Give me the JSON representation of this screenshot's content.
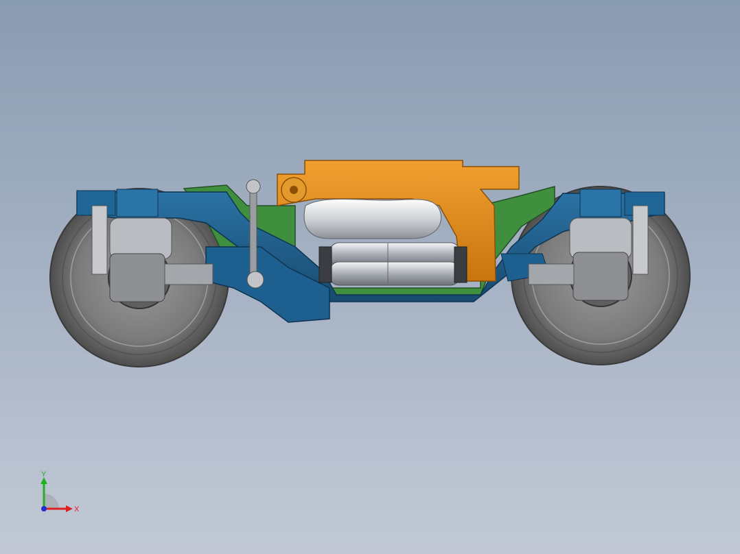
{
  "viewport": {
    "background_top": "#8a9cb1",
    "background_bottom": "#c2c9d6"
  },
  "model": {
    "parts": [
      {
        "name": "wheel",
        "color": "#6e6e6e"
      },
      {
        "name": "bogie-frame",
        "color": "#1e5f8c"
      },
      {
        "name": "bolster",
        "color": "#3f8f3f"
      },
      {
        "name": "traction-beam",
        "color": "#d98a1f"
      },
      {
        "name": "air-spring",
        "color": "#c9ccd2"
      },
      {
        "name": "damper-cylinders",
        "color": "#b8bcc2"
      }
    ]
  },
  "triad": {
    "x_label": "X",
    "y_label": "Y",
    "x_color": "#e02020",
    "y_color": "#20b020",
    "z_color": "#2030d0"
  }
}
